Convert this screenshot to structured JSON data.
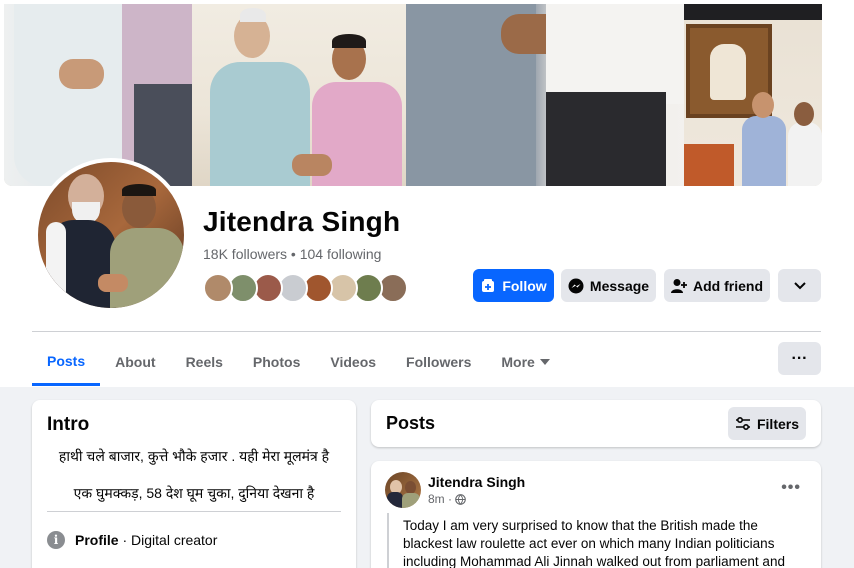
{
  "profile": {
    "name": "Jitendra Singh",
    "followers_text": "18K followers • 104 following"
  },
  "actions": {
    "follow": "Follow",
    "message": "Message",
    "add_friend": "Add friend"
  },
  "tabs": [
    {
      "label": "Posts",
      "active": true
    },
    {
      "label": "About"
    },
    {
      "label": "Reels"
    },
    {
      "label": "Photos"
    },
    {
      "label": "Videos"
    },
    {
      "label": "Followers"
    },
    {
      "label": "More"
    }
  ],
  "intro": {
    "title": "Intro",
    "bio_line1": "हाथी चले बाजार, कुत्ते भौके हजार . यही मेरा मूलमंत्र है",
    "bio_line2": "एक घुमक्कड़, 58 देश घूम चुका, दुनिया देखना है",
    "profile_label": "Profile",
    "profile_value": " · Digital creator"
  },
  "posts_section": {
    "title": "Posts",
    "filters_label": "Filters"
  },
  "post": {
    "author": "Jitendra Singh",
    "time": "8m ·",
    "text": "Today I am very surprised to know that the British made the blackest law roulette act ever on which many Indian politicians including Mohammad Ali Jinnah walked out from parliament and"
  },
  "colors": {
    "accent": "#0866ff",
    "page_bg": "#f0f2f5",
    "button_grey": "#e4e6eb",
    "secondary_text": "#65676b"
  },
  "friend_avatar_colors": [
    "#b08a6a",
    "#7e8f6b",
    "#9b5a4a",
    "#c9ccd1",
    "#a0562e",
    "#d7c4a8",
    "#6e7d4e",
    "#8a6d58"
  ]
}
